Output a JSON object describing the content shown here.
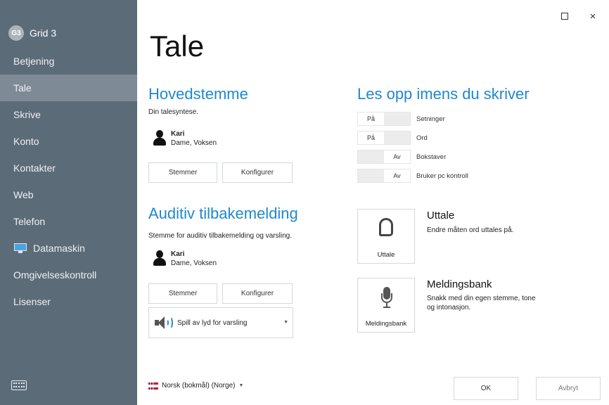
{
  "app": {
    "logo_text": "G3",
    "title": "Grid 3"
  },
  "window": {
    "maximize_label": "",
    "close_label": "×"
  },
  "sidebar": {
    "items": [
      {
        "label": "Betjening",
        "active": false
      },
      {
        "label": "Tale",
        "active": true
      },
      {
        "label": "Skrive",
        "active": false
      },
      {
        "label": "Konto",
        "active": false
      },
      {
        "label": "Kontakter",
        "active": false
      },
      {
        "label": "Web",
        "active": false
      },
      {
        "label": "Telefon",
        "active": false
      },
      {
        "label": "Datamaskin",
        "active": false,
        "icon": "monitor-icon"
      },
      {
        "label": "Omgivelseskontroll",
        "active": false
      },
      {
        "label": "Lisenser",
        "active": false
      }
    ],
    "bottom_icon": "keyboard-icon"
  },
  "page": {
    "title": "Tale"
  },
  "main_voice": {
    "title": "Hovedstemme",
    "description": "Din talesyntese.",
    "voice_name": "Kari",
    "voice_detail": "Dame, Voksen",
    "voices_button": "Stemmer",
    "configure_button": "Konfigurer"
  },
  "auditory": {
    "title": "Auditiv tilbakemelding",
    "description": "Stemme for auditiv tilbakemelding og varsling.",
    "voice_name": "Kari",
    "voice_detail": "Dame, Voksen",
    "voices_button": "Stemmer",
    "configure_button": "Konfigurer",
    "dropdown_value": "Spill av lyd for varsling"
  },
  "read_aloud": {
    "title": "Les opp imens du skriver",
    "toggles": [
      {
        "label": "Setninger",
        "on_text": "På",
        "off_text": "",
        "state": "on"
      },
      {
        "label": "Ord",
        "on_text": "På",
        "off_text": "",
        "state": "on"
      },
      {
        "label": "Bokstaver",
        "on_text": "",
        "off_text": "Av",
        "state": "off"
      },
      {
        "label": "Bruker pc kontroll",
        "on_text": "",
        "off_text": "Av",
        "state": "off"
      }
    ]
  },
  "pronunciation": {
    "tile_label": "Uttale",
    "title": "Uttale",
    "description": "Endre måten ord uttales på."
  },
  "message_bank": {
    "tile_label": "Meldingsbank",
    "title": "Meldingsbank",
    "description": "Snakk med din egen stemme, tone og intonasjon."
  },
  "footer": {
    "language": "Norsk (bokmål) (Norge)",
    "ok_button": "OK",
    "cancel_button": "Avbryt"
  }
}
